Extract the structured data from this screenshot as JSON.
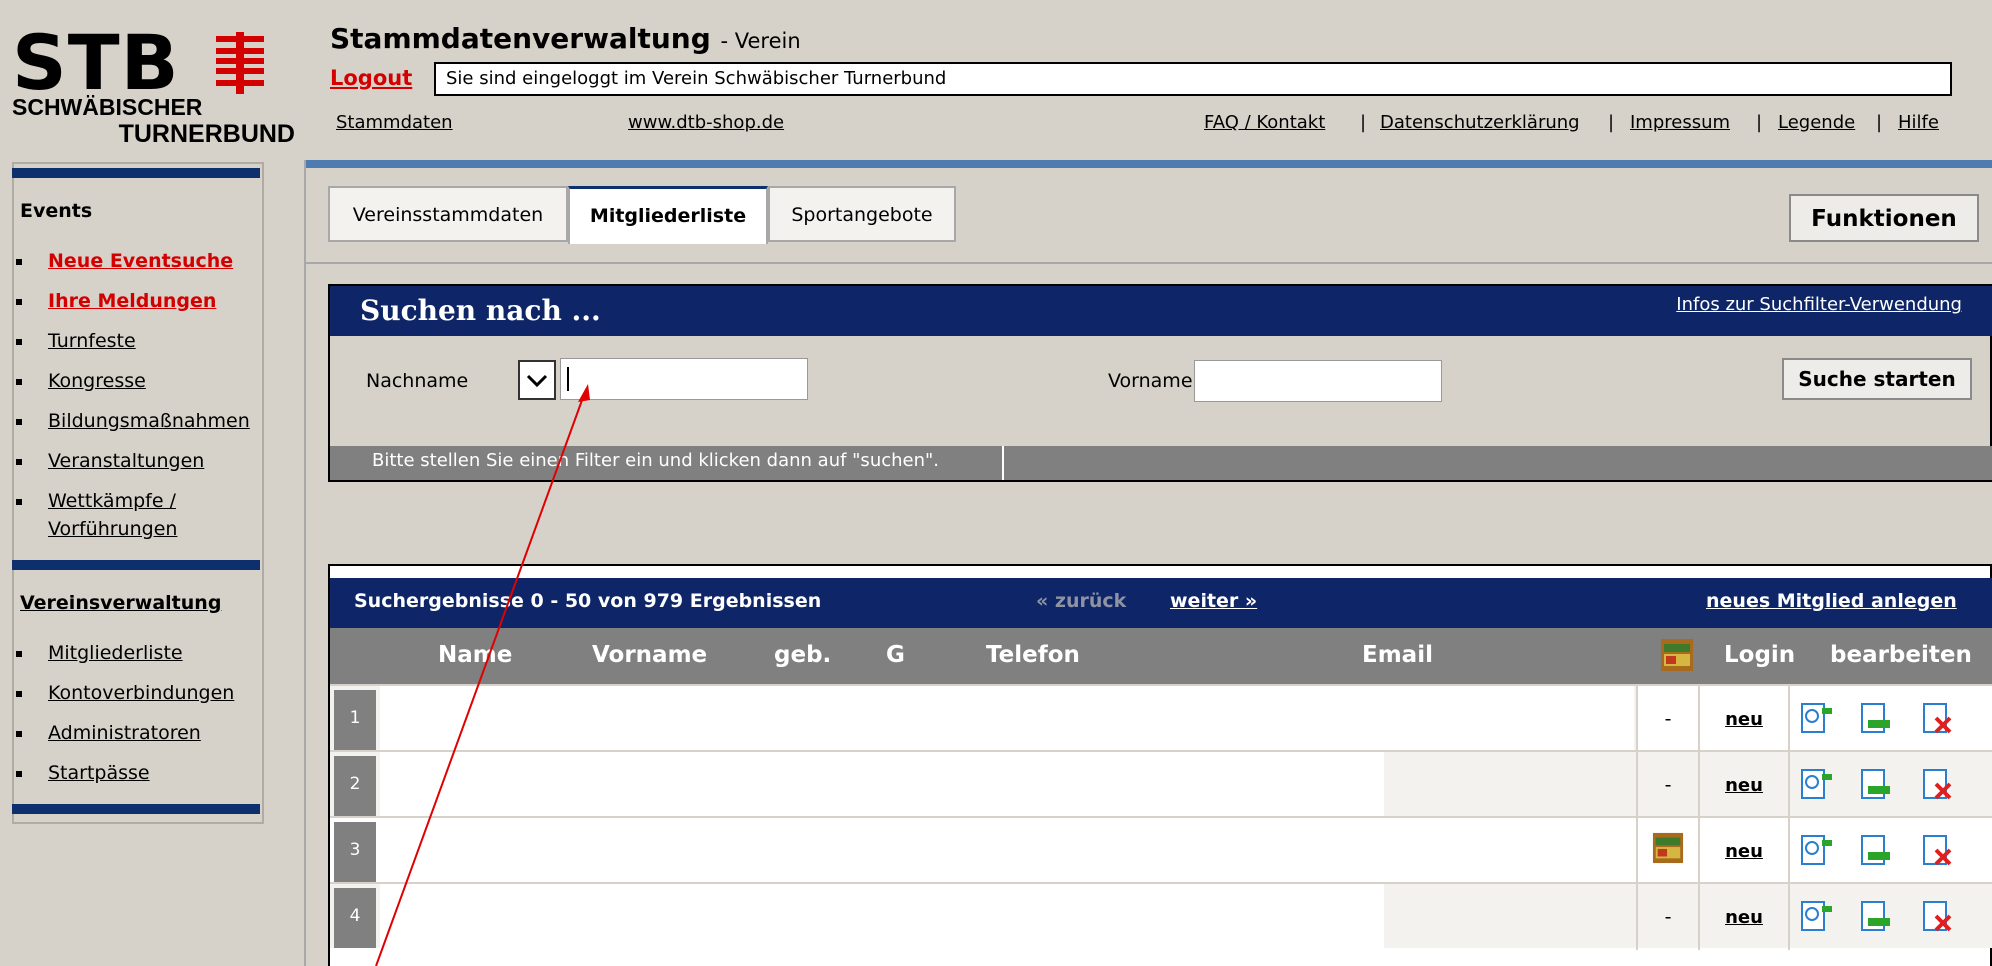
{
  "header": {
    "logo_text": "STB",
    "logo_line1": "SCHWÄBISCHER",
    "logo_line2": "TURNERBUND",
    "title": "Stammdatenverwaltung",
    "title_sub": "- Verein",
    "logout": "Logout",
    "login_info": "Sie sind eingeloggt im Verein Schwäbischer Turnerbund",
    "links": {
      "stammdaten": "Stammdaten",
      "shop": "www.dtb-shop.de",
      "faq": "FAQ / Kontakt",
      "datenschutz": "Datenschutzerklärung",
      "impressum": "Impressum",
      "legende": "Legende",
      "hilfe": "Hilfe"
    },
    "separator": "|"
  },
  "sidebar": {
    "events_title": "Events",
    "events": [
      {
        "label": "Neue Eventsuche",
        "highlight": true
      },
      {
        "label": "Ihre Meldungen",
        "highlight": true
      },
      {
        "label": "Turnfeste",
        "highlight": false
      },
      {
        "label": "Kongresse",
        "highlight": false
      },
      {
        "label": "Bildungsmaßnahmen",
        "highlight": false
      },
      {
        "label": "Veranstaltungen",
        "highlight": false
      },
      {
        "label": "Wettkämpfe /",
        "label2": "Vorführungen",
        "highlight": false
      }
    ],
    "verein_title": "Vereinsverwaltung",
    "verein": [
      {
        "label": "Mitgliederliste"
      },
      {
        "label": "Kontoverbindungen"
      },
      {
        "label": "Administratoren"
      },
      {
        "label": "Startpässe"
      }
    ]
  },
  "tabs": [
    {
      "label": "Vereinsstammdaten",
      "active": false
    },
    {
      "label": "Mitgliederliste",
      "active": true
    },
    {
      "label": "Sportangebote",
      "active": false
    }
  ],
  "funktionen_button": "Funktionen",
  "search": {
    "title": "Suchen nach ...",
    "info_link": "Infos zur Suchfilter-Verwendung",
    "nachname_label": "Nachname",
    "nachname_value": "",
    "vorname_label": "Vorname",
    "vorname_value": "",
    "submit": "Suche starten",
    "hint": "Bitte stellen Sie einen Filter ein und klicken dann auf \"suchen\"."
  },
  "results": {
    "summary": "Suchergebnisse 0 - 50 von 979 Ergebnissen",
    "back": "« zurück",
    "forward": "weiter »",
    "new_member": "neues Mitglied anlegen",
    "columns": [
      "Name",
      "Vorname",
      "geb.",
      "G",
      "Telefon",
      "Email",
      "Login",
      "bearbeiten"
    ],
    "rows": [
      {
        "num": "1",
        "status": "-",
        "login": "neu"
      },
      {
        "num": "2",
        "status": "-",
        "login": "neu"
      },
      {
        "num": "3",
        "status": "passport-icon",
        "login": "neu"
      },
      {
        "num": "4",
        "status": "-",
        "login": "neu"
      }
    ]
  },
  "colors": {
    "navy": "#0e2667",
    "red": "#d40000",
    "grey_bar": "#808080",
    "page_bg": "#d6d2ca",
    "accent_line": "#4e7bb0"
  }
}
